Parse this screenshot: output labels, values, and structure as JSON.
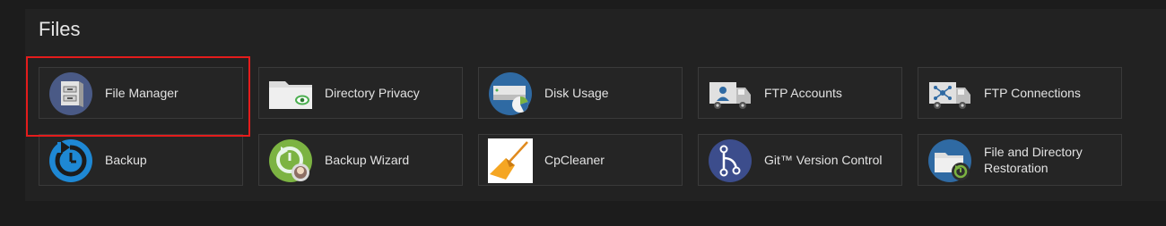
{
  "section": {
    "title": "Files"
  },
  "tiles": [
    {
      "label": "File Manager",
      "icon": "file-manager-icon"
    },
    {
      "label": "Directory Privacy",
      "icon": "directory-privacy-icon"
    },
    {
      "label": "Disk Usage",
      "icon": "disk-usage-icon"
    },
    {
      "label": "FTP Accounts",
      "icon": "ftp-accounts-icon"
    },
    {
      "label": "FTP Connections",
      "icon": "ftp-connections-icon"
    },
    {
      "label": "Backup",
      "icon": "backup-icon"
    },
    {
      "label": "Backup Wizard",
      "icon": "backup-wizard-icon"
    },
    {
      "label": "CpCleaner",
      "icon": "cpcleaner-icon"
    },
    {
      "label": "Git™ Version Control",
      "icon": "git-version-control-icon"
    },
    {
      "label": "File and Directory Restoration",
      "icon": "file-restoration-icon"
    }
  ],
  "colors": {
    "highlight": "#e41c1c",
    "accent_blue": "#2f6aa3",
    "accent_green": "#7cb342"
  }
}
